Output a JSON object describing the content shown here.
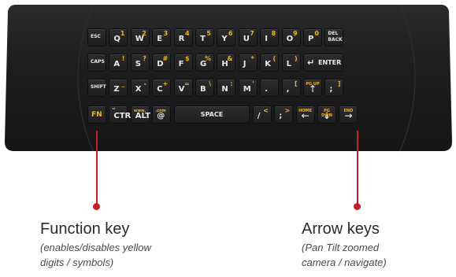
{
  "keyboard": {
    "row1": [
      {
        "main": "ESC",
        "sec": "",
        "small": true
      },
      {
        "main": "Q",
        "sec": "1"
      },
      {
        "main": "W",
        "sec": "2"
      },
      {
        "main": "E",
        "sec": "3"
      },
      {
        "main": "R",
        "sec": "4"
      },
      {
        "main": "T",
        "sec": "5"
      },
      {
        "main": "Y",
        "sec": "6"
      },
      {
        "main": "U",
        "sec": "7"
      },
      {
        "main": "I",
        "sec": "8"
      },
      {
        "main": "O",
        "sec": "9"
      },
      {
        "main": "P",
        "sec": "0"
      },
      {
        "main": "DEL BACK",
        "sec": "",
        "small": true,
        "dual": true
      }
    ],
    "row2": [
      {
        "main": "CAPS",
        "sec": "",
        "small": true
      },
      {
        "main": "A",
        "sec": "!"
      },
      {
        "main": "S",
        "sec": "?"
      },
      {
        "main": "D",
        "sec": "#"
      },
      {
        "main": "F",
        "sec": "$"
      },
      {
        "main": "G",
        "sec": "%"
      },
      {
        "main": "H",
        "sec": "&"
      },
      {
        "main": "J",
        "sec": "*"
      },
      {
        "main": "K",
        "sec": "("
      },
      {
        "main": "L",
        "sec": ")"
      }
    ],
    "enter": "ENTER",
    "enter_glyph": "↵",
    "row3": [
      {
        "main": "SHIFT",
        "sec": "",
        "small": true
      },
      {
        "main": "Z",
        "sec": "_"
      },
      {
        "main": "X",
        "sec": "-"
      },
      {
        "main": "C",
        "sec": "+"
      },
      {
        "main": "V",
        "sec": "="
      },
      {
        "main": "B",
        "sec": "\\"
      },
      {
        "main": "N",
        "sec": ":"
      },
      {
        "main": "M",
        "sec": "'"
      },
      {
        "main": ".",
        "sec": ""
      },
      {
        "main": ",",
        "sec": "["
      },
      {
        "main": "↑",
        "sec": "PG UP",
        "arrow": true
      },
      {
        "main": ";",
        "sec": "]"
      }
    ],
    "row4": [
      {
        "main": "FN",
        "sec": "",
        "fn": true
      },
      {
        "main": "CTRL",
        "sec": "\"",
        "secLeft": true
      },
      {
        "main": "ALT",
        "sec": "www.",
        "secLeft": true
      },
      {
        "main": "@",
        "sec": ".com",
        "secLeft": true
      }
    ],
    "space": "SPACE",
    "row4b": [
      {
        "main": "/",
        "sec": "<"
      },
      {
        "main": ";",
        "sec": ">"
      },
      {
        "main": "←",
        "sec": "HOME",
        "arrow": true
      },
      {
        "main": "↓",
        "sec": "PG DWN",
        "arrow": true
      },
      {
        "main": "→",
        "sec": "END",
        "arrow": true
      }
    ]
  },
  "callouts": {
    "function": {
      "title": "Function key",
      "desc1": "(enables/disables yellow",
      "desc2": "digits / symbols)"
    },
    "arrows": {
      "title": "Arrow keys",
      "desc1": "(Pan Tilt zoomed",
      "desc2": "camera / navigate)"
    }
  },
  "colors": {
    "body": "#1b1b1d",
    "key": "#2a2a2c",
    "yellow": "#f2b515",
    "callout": "#c41e2a"
  }
}
